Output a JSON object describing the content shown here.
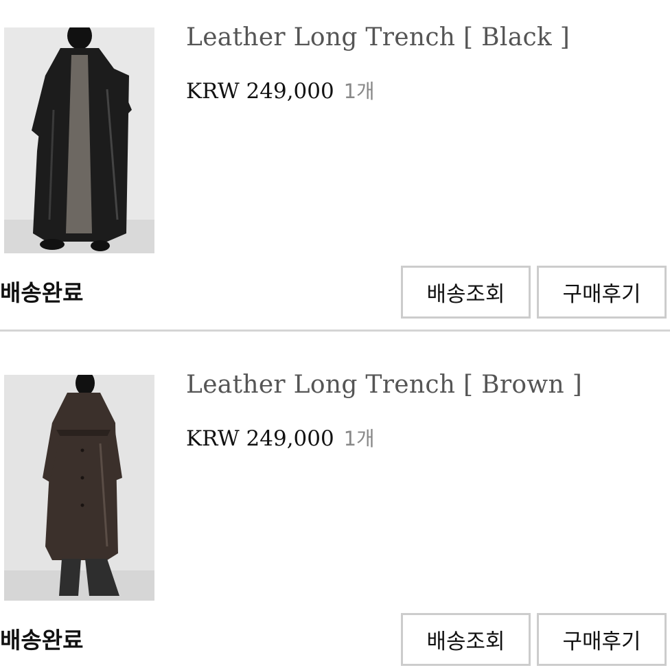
{
  "orders": [
    {
      "product_name": "Leather Long Trench [ Black ]",
      "price": "KRW 249,000",
      "quantity": "1개",
      "status": "배송완료",
      "track_label": "배송조회",
      "review_label": "구매후기",
      "coat_color": "#1c1c1c",
      "inner_color": "#6d6862"
    },
    {
      "product_name": "Leather Long Trench [ Brown ]",
      "price": "KRW 249,000",
      "quantity": "1개",
      "status": "배송완료",
      "track_label": "배송조회",
      "review_label": "구매후기",
      "coat_color": "#3b302b",
      "inner_color": "#2e2e2e"
    }
  ]
}
